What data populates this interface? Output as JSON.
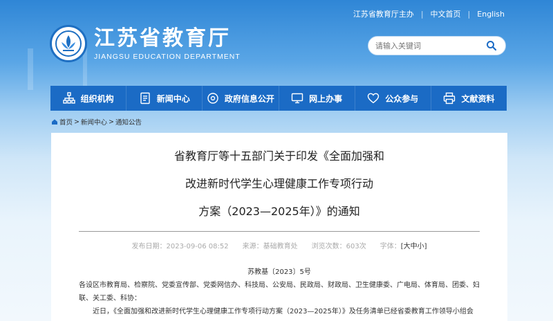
{
  "topbar": {
    "sponsor": "江苏省教育厅主办",
    "home_cn": "中文首页",
    "english": "English"
  },
  "logo": {
    "name_cn": "江苏省教育厅",
    "name_en": "JIANGSU EDUCATION DEPARTMENT"
  },
  "search": {
    "placeholder": "请输入关键词"
  },
  "nav": {
    "items": [
      {
        "label": "组织机构",
        "icon": "org-chart-icon"
      },
      {
        "label": "新闻中心",
        "icon": "document-icon"
      },
      {
        "label": "政府信息公开",
        "icon": "info-disclosure-icon"
      },
      {
        "label": "网上办事",
        "icon": "monitor-icon"
      },
      {
        "label": "公众参与",
        "icon": "heart-icon"
      },
      {
        "label": "文献资料",
        "icon": "printer-icon"
      }
    ]
  },
  "breadcrumb": {
    "items": [
      "首页",
      "新闻中心",
      "通知公告"
    ],
    "separator": ">"
  },
  "article": {
    "title_line1": "省教育厅等十五部门关于印发《全面加强和",
    "title_line2": "改进新时代学生心理健康工作专项行动",
    "title_line3": "方案（2023—2025年）》的通知",
    "publish_label": "发布日期：",
    "publish_date": "2023-09-06 08:52",
    "source_label": "来源：",
    "source": "基础教育处",
    "views_label": "浏览次数：",
    "views": "603次",
    "font_label": "字体：",
    "font_bracket_open": "[",
    "font_large": "大",
    "font_medium": "中",
    "font_small": "小",
    "font_bracket_close": "]",
    "doc_number": "苏教基〔2023〕5号",
    "addressees": "各设区市教育局、检察院、党委宣传部、党委网信办、科技局、公安局、民政局、财政局、卫生健康委、广电局、体育局、团委、妇联、关工委、科协：",
    "para1": "近日，《全面加强和改进新时代学生心理健康工作专项行动方案（2023—2025年）》及任务清单已经省委教育工作领导小组会"
  },
  "colors": {
    "nav_bg": "#1b6bc5",
    "header_top": "#2f86d6",
    "card_bg": "#ffffff"
  }
}
